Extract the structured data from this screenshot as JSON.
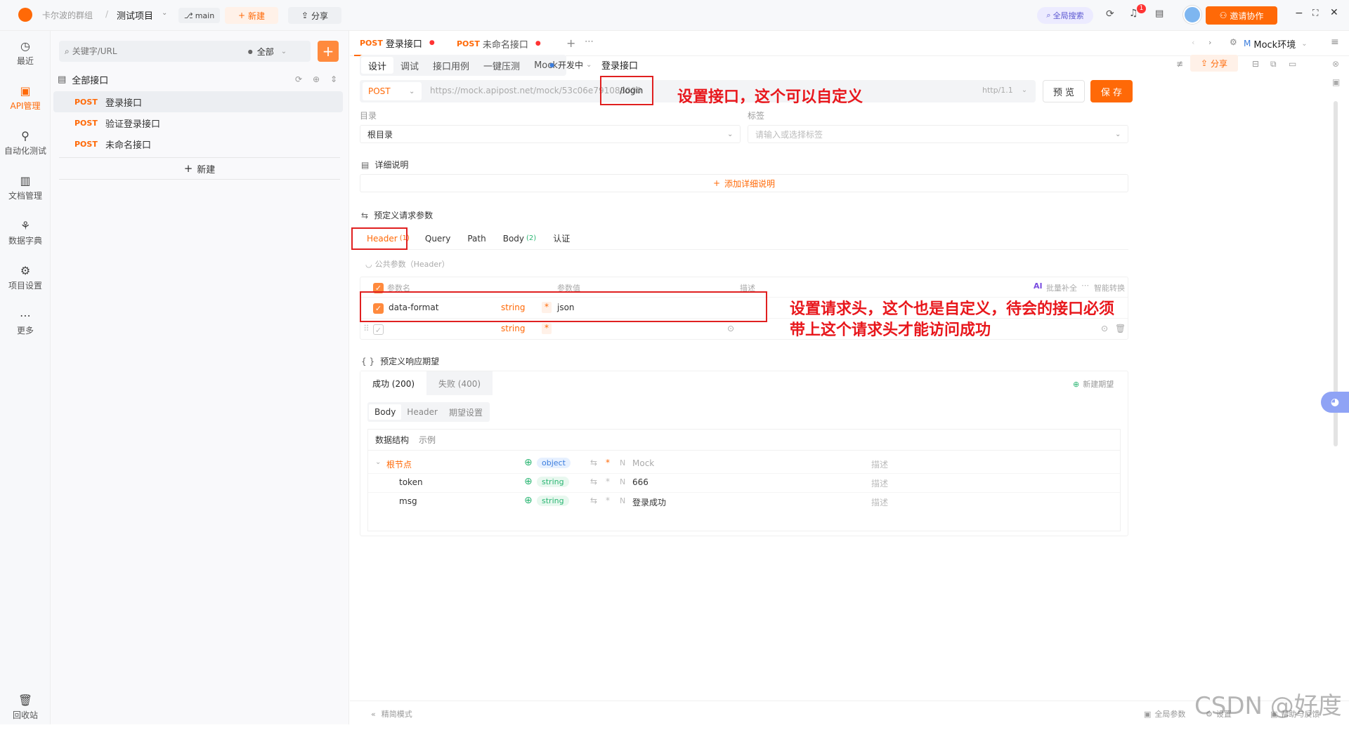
{
  "topbar": {
    "team": "卡尔波的群组",
    "sep": "/",
    "project": "测试项目",
    "branch": "main",
    "new_label": "新建",
    "share_label": "分享",
    "global_search": "全局搜索",
    "notif_count": "1",
    "invite_label": "邀请协作"
  },
  "leftnav": {
    "items": [
      {
        "label": "最近",
        "icon": "clock-icon"
      },
      {
        "label": "API管理",
        "icon": "api-icon"
      },
      {
        "label": "自动化测试",
        "icon": "flow-icon"
      },
      {
        "label": "文档管理",
        "icon": "doc-icon"
      },
      {
        "label": "数据字典",
        "icon": "dict-icon"
      },
      {
        "label": "项目设置",
        "icon": "settings-icon"
      },
      {
        "label": "更多",
        "icon": "more-icon"
      }
    ],
    "trash": "回收站"
  },
  "tree": {
    "search_placeholder": "关键字/URL",
    "filter": "全部",
    "root": "全部接口",
    "items": [
      {
        "method": "POST",
        "name": "登录接口"
      },
      {
        "method": "POST",
        "name": "验证登录接口"
      },
      {
        "method": "POST",
        "name": "未命名接口"
      }
    ],
    "new_label": "新建"
  },
  "tabs": [
    {
      "method": "POST",
      "name": "登录接口"
    },
    {
      "method": "POST",
      "name": "未命名接口"
    }
  ],
  "env": {
    "badge": "M",
    "name": "Mock环境"
  },
  "subtabs": [
    "设计",
    "调试",
    "接口用例",
    "一键压测",
    "Mock"
  ],
  "status": "开发中",
  "api_name": "登录接口",
  "share": "分享",
  "url": {
    "method": "POST",
    "prefix": "https://mock.apipost.net/mock/53c06e791088000",
    "path": "/login",
    "protocol": "http/1.1",
    "preview": "预 览",
    "save": "保 存"
  },
  "annotations": {
    "a1": "设置接口，这个可以自定义",
    "a2_line1": "设置请求头，这个也是自定义，待会的接口必须",
    "a2_line2": "带上这个请求头才能访问成功"
  },
  "form": {
    "dir_label": "目录",
    "dir_value": "根目录",
    "tag_label": "标签",
    "tag_placeholder": "请输入或选择标签",
    "detail_title": "详细说明",
    "detail_add": "添加详细说明",
    "params_title": "预定义请求参数"
  },
  "param_tabs": [
    {
      "label": "Header",
      "count": "(1)"
    },
    {
      "label": "Query",
      "count": ""
    },
    {
      "label": "Path",
      "count": ""
    },
    {
      "label": "Body",
      "count": "(2)"
    },
    {
      "label": "认证",
      "count": ""
    }
  ],
  "public_params": "公共参数（Header）",
  "header_table": {
    "col_name": "参数名",
    "col_value": "参数值",
    "col_desc": "描述",
    "ai": "AI",
    "batch": "批量补全",
    "smart": "智能转换",
    "rows": [
      {
        "name": "data-format",
        "type": "string",
        "value": "json"
      },
      {
        "name": "",
        "type": "string",
        "value": ""
      }
    ]
  },
  "response": {
    "title": "预定义响应期望",
    "tab_ok": "成功 (200)",
    "tab_fail": "失败 (400)",
    "new_expect": "新建期望",
    "inner_tabs": [
      "Body",
      "Header",
      "期望设置"
    ],
    "struct_tabs": [
      "数据结构",
      "示例"
    ],
    "rows": [
      {
        "name": "根节点",
        "type": "object",
        "mock": "Mock",
        "desc": "描述"
      },
      {
        "name": "token",
        "type": "string",
        "mock": "666",
        "desc": "描述"
      },
      {
        "name": "msg",
        "type": "string",
        "mock": "登录成功",
        "desc": "描述"
      }
    ]
  },
  "footer": {
    "compact": "精简模式",
    "global_params": "全局参数",
    "settings": "设置",
    "help": "帮助与反馈"
  },
  "watermark": "CSDN @好度"
}
